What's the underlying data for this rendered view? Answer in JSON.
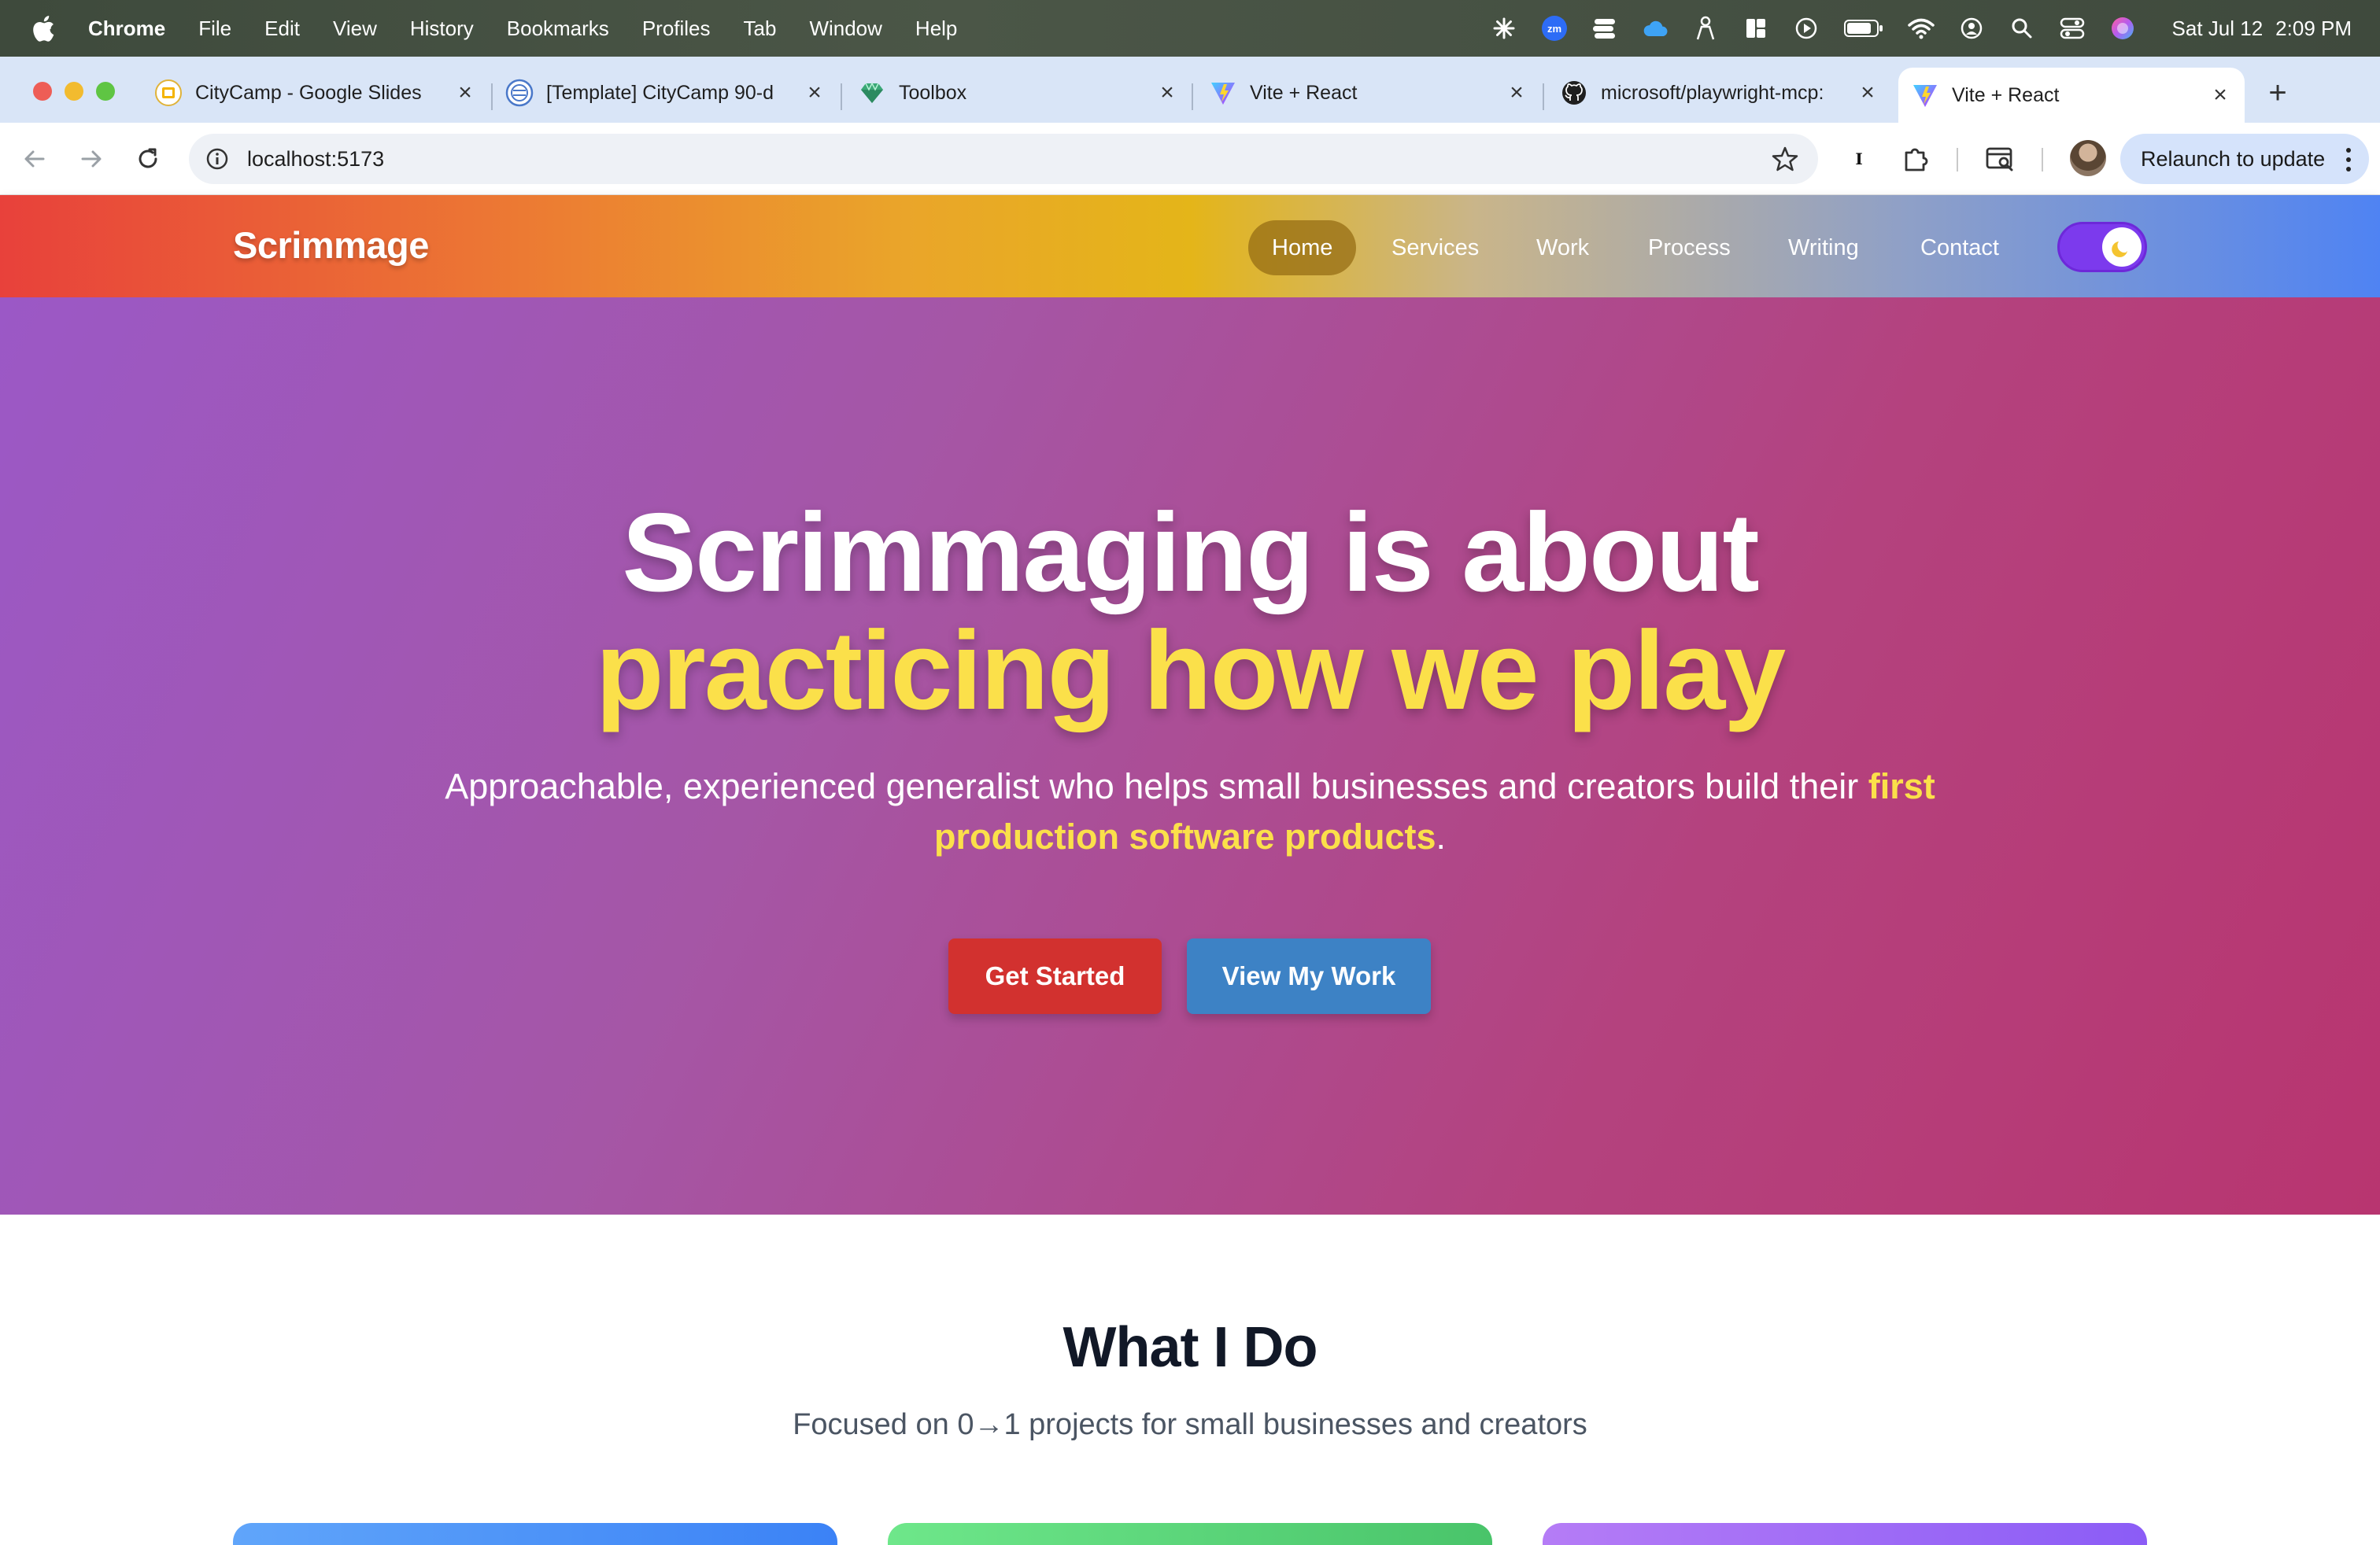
{
  "menubar": {
    "app_name": "Chrome",
    "items": [
      "File",
      "Edit",
      "View",
      "History",
      "Bookmarks",
      "Profiles",
      "Tab",
      "Window",
      "Help"
    ],
    "date": "Sat Jul 12",
    "time": "2:09 PM",
    "status_icons": [
      "asterisk-icon",
      "zoom-icon",
      "stack-icon",
      "cloud-icon",
      "person-icon",
      "layout-icon",
      "play-icon",
      "battery-icon",
      "wifi-icon",
      "user-circle-icon",
      "search-icon",
      "control-center-icon",
      "siri-icon"
    ]
  },
  "tabs": [
    {
      "title": "CityCamp - Google Slides",
      "icon": "slides-icon"
    },
    {
      "title": "[Template] CityCamp 90-d",
      "icon": "globe-icon"
    },
    {
      "title": "Toolbox",
      "icon": "gem-icon"
    },
    {
      "title": "Vite + React",
      "icon": "vite-icon"
    },
    {
      "title": "microsoft/playwright-mcp:",
      "icon": "github-icon"
    },
    {
      "title": "Vite + React",
      "icon": "vite-icon",
      "active": true
    }
  ],
  "toolbar": {
    "url": "localhost:5173",
    "relaunch_label": "Relaunch to update"
  },
  "site": {
    "logo": "Scrimmage",
    "nav": [
      "Home",
      "Services",
      "Work",
      "Process",
      "Writing",
      "Contact"
    ],
    "active_nav": "Home",
    "theme_toggle": "dark",
    "hero": {
      "title_line1": "Scrimmaging is about",
      "title_line2": "practicing how we play",
      "subtitle_before": "Approachable, experienced generalist who helps small businesses and creators build their ",
      "subtitle_highlight": "first production software products",
      "subtitle_after": ".",
      "primary_cta": "Get Started",
      "secondary_cta": "View My Work"
    },
    "what_i_do": {
      "title": "What I Do",
      "subtitle": "Focused on 0→1 projects for small businesses and creators"
    }
  },
  "colors": {
    "accent_yellow": "#fbe04a",
    "primary_button": "#d2312f",
    "secondary_button": "#3d82c5",
    "toggle": "#7c3aed"
  }
}
